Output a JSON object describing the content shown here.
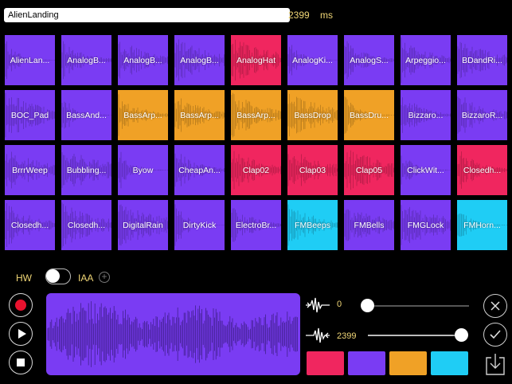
{
  "header": {
    "sample_name": "AlienLanding",
    "duration_value": "2399",
    "duration_unit": "ms"
  },
  "pads": [
    {
      "label": "AlienLan...",
      "color": "#7a3cf3"
    },
    {
      "label": "AnalogB...",
      "color": "#7a3cf3"
    },
    {
      "label": "AnalogB...",
      "color": "#7a3cf3"
    },
    {
      "label": "AnalogB...",
      "color": "#7a3cf3"
    },
    {
      "label": "AnalogHat",
      "color": "#f0265f"
    },
    {
      "label": "AnalogKi...",
      "color": "#7a3cf3"
    },
    {
      "label": "AnalogS...",
      "color": "#7a3cf3"
    },
    {
      "label": "Arpeggio...",
      "color": "#7a3cf3"
    },
    {
      "label": "BDandRi...",
      "color": "#7a3cf3"
    },
    {
      "label": "BOC_Pad",
      "color": "#7a3cf3"
    },
    {
      "label": "BassAnd...",
      "color": "#7a3cf3"
    },
    {
      "label": "BassArp...",
      "color": "#f0a126"
    },
    {
      "label": "BassArp...",
      "color": "#f0a126"
    },
    {
      "label": "BassArp...",
      "color": "#f0a126"
    },
    {
      "label": "BassDrop",
      "color": "#f0a126"
    },
    {
      "label": "BassDru...",
      "color": "#f0a126"
    },
    {
      "label": "Bizzaro...",
      "color": "#7a3cf3"
    },
    {
      "label": "BizzaroR...",
      "color": "#7a3cf3"
    },
    {
      "label": "BrrrWeep",
      "color": "#7a3cf3"
    },
    {
      "label": "Bubbling...",
      "color": "#7a3cf3"
    },
    {
      "label": "Byow",
      "color": "#7a3cf3"
    },
    {
      "label": "CheapAn...",
      "color": "#7a3cf3"
    },
    {
      "label": "Clap02",
      "color": "#f0265f"
    },
    {
      "label": "Clap03",
      "color": "#f0265f"
    },
    {
      "label": "Clap05",
      "color": "#f0265f"
    },
    {
      "label": "ClickWit...",
      "color": "#7a3cf3"
    },
    {
      "label": "Closedh...",
      "color": "#f0265f"
    },
    {
      "label": "Closedh...",
      "color": "#7a3cf3"
    },
    {
      "label": "Closedh...",
      "color": "#7a3cf3"
    },
    {
      "label": "DigitalRain",
      "color": "#7a3cf3"
    },
    {
      "label": "DirtyKick",
      "color": "#7a3cf3"
    },
    {
      "label": "ElectroBr...",
      "color": "#7a3cf3"
    },
    {
      "label": "FMBeeps",
      "color": "#1fcdf5"
    },
    {
      "label": "FMBells",
      "color": "#7a3cf3"
    },
    {
      "label": "FMGLock",
      "color": "#7a3cf3"
    },
    {
      "label": "FMHorn...",
      "color": "#1fcdf5"
    }
  ],
  "controls": {
    "hw_label": "HW",
    "iaa_label": "IAA",
    "iaa_toggle_on": false,
    "add_icon": "plus-circle-icon"
  },
  "transport": {
    "record_icon": "record-icon",
    "play_icon": "play-icon",
    "stop_icon": "stop-icon"
  },
  "editor": {
    "color": "#7a3cf3",
    "start_value": "0",
    "end_value": "2399",
    "start_fraction": 0,
    "end_fraction": 1
  },
  "swatches": [
    "#f0265f",
    "#7a3cf3",
    "#f0a126",
    "#1fcdf5"
  ],
  "actions": {
    "cancel_icon": "close-icon",
    "confirm_icon": "checkmark-icon",
    "save_icon": "download-icon"
  }
}
